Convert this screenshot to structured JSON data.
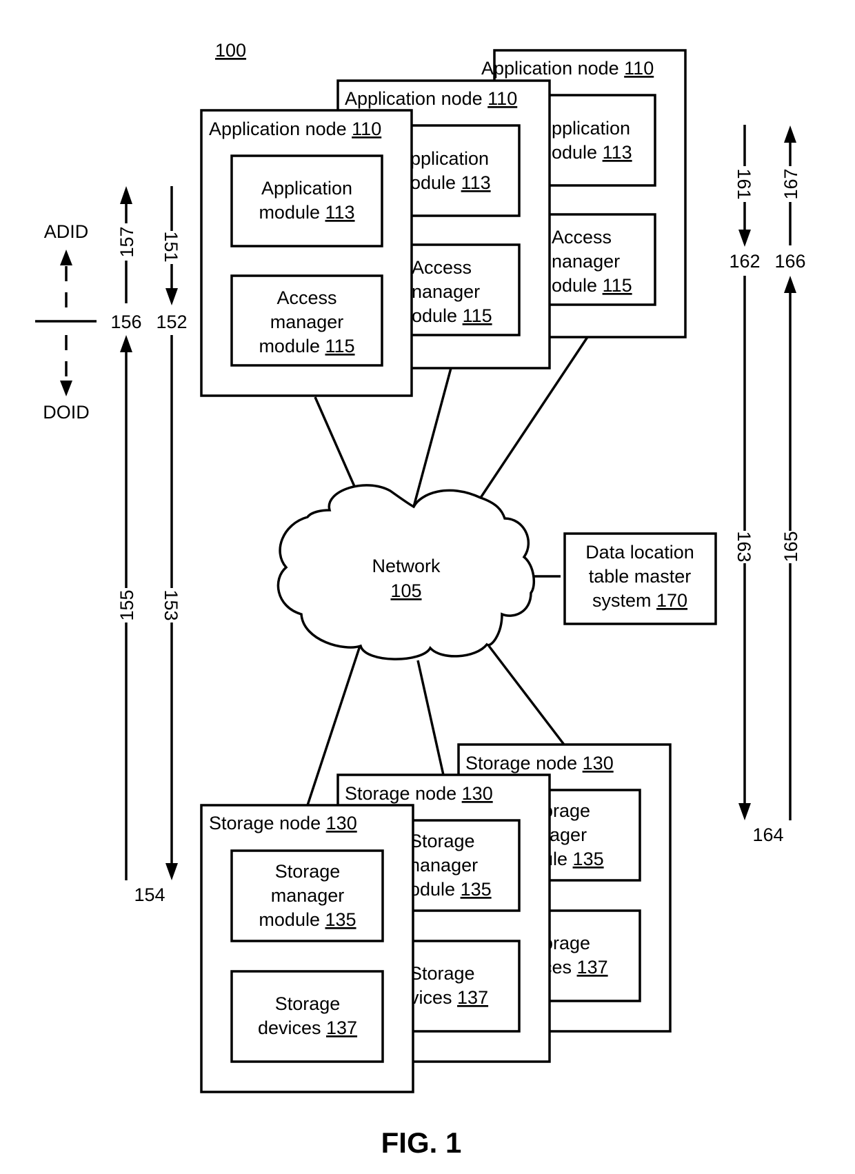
{
  "figure": {
    "system_ref": "100",
    "caption": "FIG. 1"
  },
  "application_node": {
    "title": "Application node",
    "ref": "110",
    "app_module": {
      "line1": "Application",
      "line2": "module",
      "ref": "113"
    },
    "access_module": {
      "line1": "Access",
      "line2": "manager",
      "line3": "module",
      "ref": "115"
    },
    "back_app_module": {
      "line1": "pplication",
      "line2": "odule",
      "ref": "113"
    },
    "back_access_module": {
      "line1": "Access",
      "line2": "nanager",
      "line3": "odule",
      "ref": "115"
    },
    "mid_app_module": {
      "line1": "pplication",
      "line2": "odule",
      "ref": "113"
    },
    "mid_access_module": {
      "line1": "Access",
      "line2": "nanager",
      "line3": "odule",
      "ref": "115"
    }
  },
  "network": {
    "label": "Network",
    "ref": "105"
  },
  "dlt_master": {
    "line1": "Data location",
    "line2": "table master",
    "line3": "system",
    "ref": "170"
  },
  "storage_node": {
    "title": "Storage node",
    "ref": "130",
    "manager_module": {
      "line1": "Storage",
      "line2": "manager",
      "line3": "module",
      "ref": "135"
    },
    "devices": {
      "line1": "Storage",
      "line2": "devices",
      "ref": "137"
    },
    "mid_manager_module": {
      "line1": "Storage",
      "line2": "nanager",
      "line3": "odule",
      "ref": "135"
    },
    "mid_devices": {
      "line1": "Storage",
      "line2": "vices",
      "ref": "137"
    },
    "back_manager_module": {
      "line1": "orage",
      "line2": "nager",
      "line3": "ule",
      "ref": "135"
    },
    "back_devices": {
      "line1": "orage",
      "line2": "ces",
      "ref": "137"
    }
  },
  "left_legend": {
    "adid": "ADID",
    "doid": "DOID",
    "refs": {
      "r151": "151",
      "r152": "152",
      "r153": "153",
      "r154": "154",
      "r155": "155",
      "r156": "156",
      "r157": "157"
    }
  },
  "right_legend": {
    "refs": {
      "r161": "161",
      "r162": "162",
      "r163": "163",
      "r164": "164",
      "r165": "165",
      "r166": "166",
      "r167": "167"
    }
  }
}
